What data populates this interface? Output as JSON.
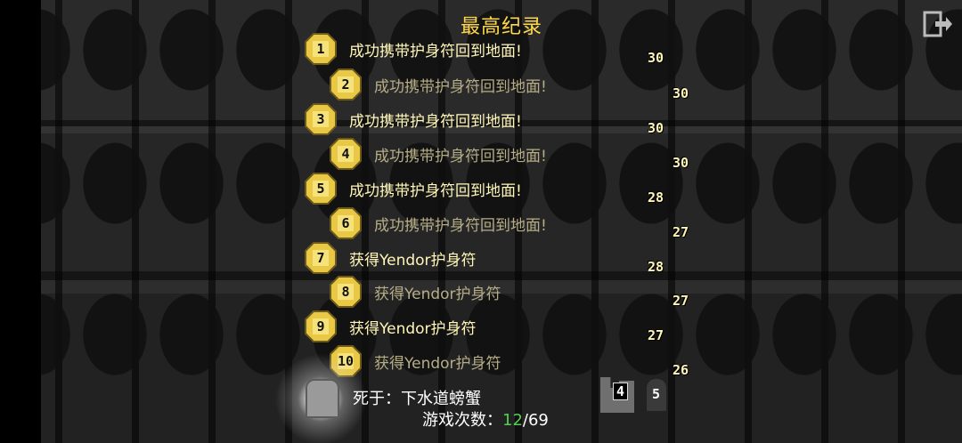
{
  "title": "最高纪录",
  "icons": {
    "exit": "exit-door-icon",
    "medal": "medal-icon",
    "tombstone": "tombstone-icon"
  },
  "colors": {
    "title": "#ffd84a",
    "highlight": "#fff6b8",
    "dim": "#b6ad86",
    "current_games": "#4fd14f"
  },
  "records": [
    {
      "rank": "1",
      "text": "成功携带护身符回到地面!",
      "depth": "30"
    },
    {
      "rank": "2",
      "text": "成功携带护身符回到地面!",
      "depth": "30"
    },
    {
      "rank": "3",
      "text": "成功携带护身符回到地面!",
      "depth": "30"
    },
    {
      "rank": "4",
      "text": "成功携带护身符回到地面!",
      "depth": "30"
    },
    {
      "rank": "5",
      "text": "成功携带护身符回到地面!",
      "depth": "28"
    },
    {
      "rank": "6",
      "text": "成功携带护身符回到地面!",
      "depth": "27"
    },
    {
      "rank": "7",
      "text": "获得Yendor护身符",
      "depth": "28"
    },
    {
      "rank": "8",
      "text": "获得Yendor护身符",
      "depth": "27"
    },
    {
      "rank": "9",
      "text": "获得Yendor护身符",
      "depth": "27"
    },
    {
      "rank": "10",
      "text": "获得Yendor护身符",
      "depth": "26"
    }
  ],
  "latest": {
    "death": "死于：下水道螃蟹",
    "depth": "4",
    "level": "5",
    "games_label": "游戏次数：",
    "games_current": "12",
    "games_sep": "/",
    "games_total": "69"
  }
}
